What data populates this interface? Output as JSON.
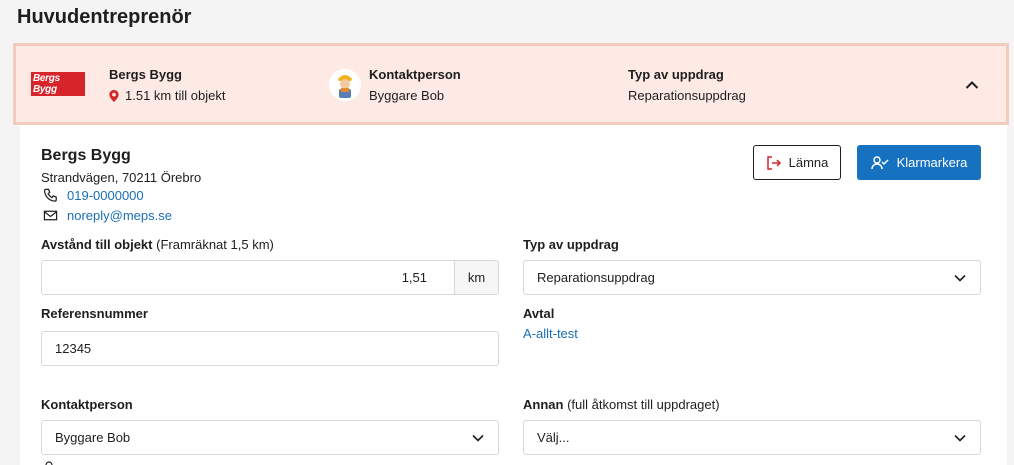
{
  "page": {
    "title": "Huvudentreprenör"
  },
  "summary": {
    "logo_text": "Bergs Bygg",
    "company": {
      "name": "Bergs Bygg",
      "distance": "1.51 km till objekt",
      "icon": "map-pin-icon"
    },
    "contact": {
      "label": "Kontaktperson",
      "name": "Byggare Bob"
    },
    "assignment": {
      "label": "Typ av uppdrag",
      "value": "Reparationsuppdrag"
    },
    "collapse_icon": "chevron-up-icon",
    "colors": {
      "background": "#fdeae4",
      "border": "#f2cdbd"
    }
  },
  "details": {
    "company_name": "Bergs Bygg",
    "address": "Strandvägen, 70211 Örebro",
    "phone": "019-0000000",
    "email": "noreply@meps.se",
    "buttons": {
      "leave": "Lämna",
      "mark_done": "Klarmarkera"
    },
    "distance": {
      "label": "Avstånd till objekt",
      "hint": "(Framräknat 1,5 km)",
      "value": "1,51",
      "unit": "km"
    },
    "assignment_type": {
      "label": "Typ av uppdrag",
      "selected": "Reparationsuppdrag"
    },
    "reference": {
      "label": "Referensnummer",
      "value": "12345"
    },
    "agreement": {
      "label": "Avtal",
      "value": "A-allt-test"
    },
    "contact_person": {
      "label": "Kontaktperson",
      "selected": "Byggare Bob"
    },
    "other": {
      "label": "Annan",
      "hint": "(full åtkomst till uppdraget)",
      "selected": "Välj..."
    }
  },
  "colors": {
    "primary": "#1671c1",
    "link": "#1a6fb5",
    "brand_red": "#d6242b"
  }
}
